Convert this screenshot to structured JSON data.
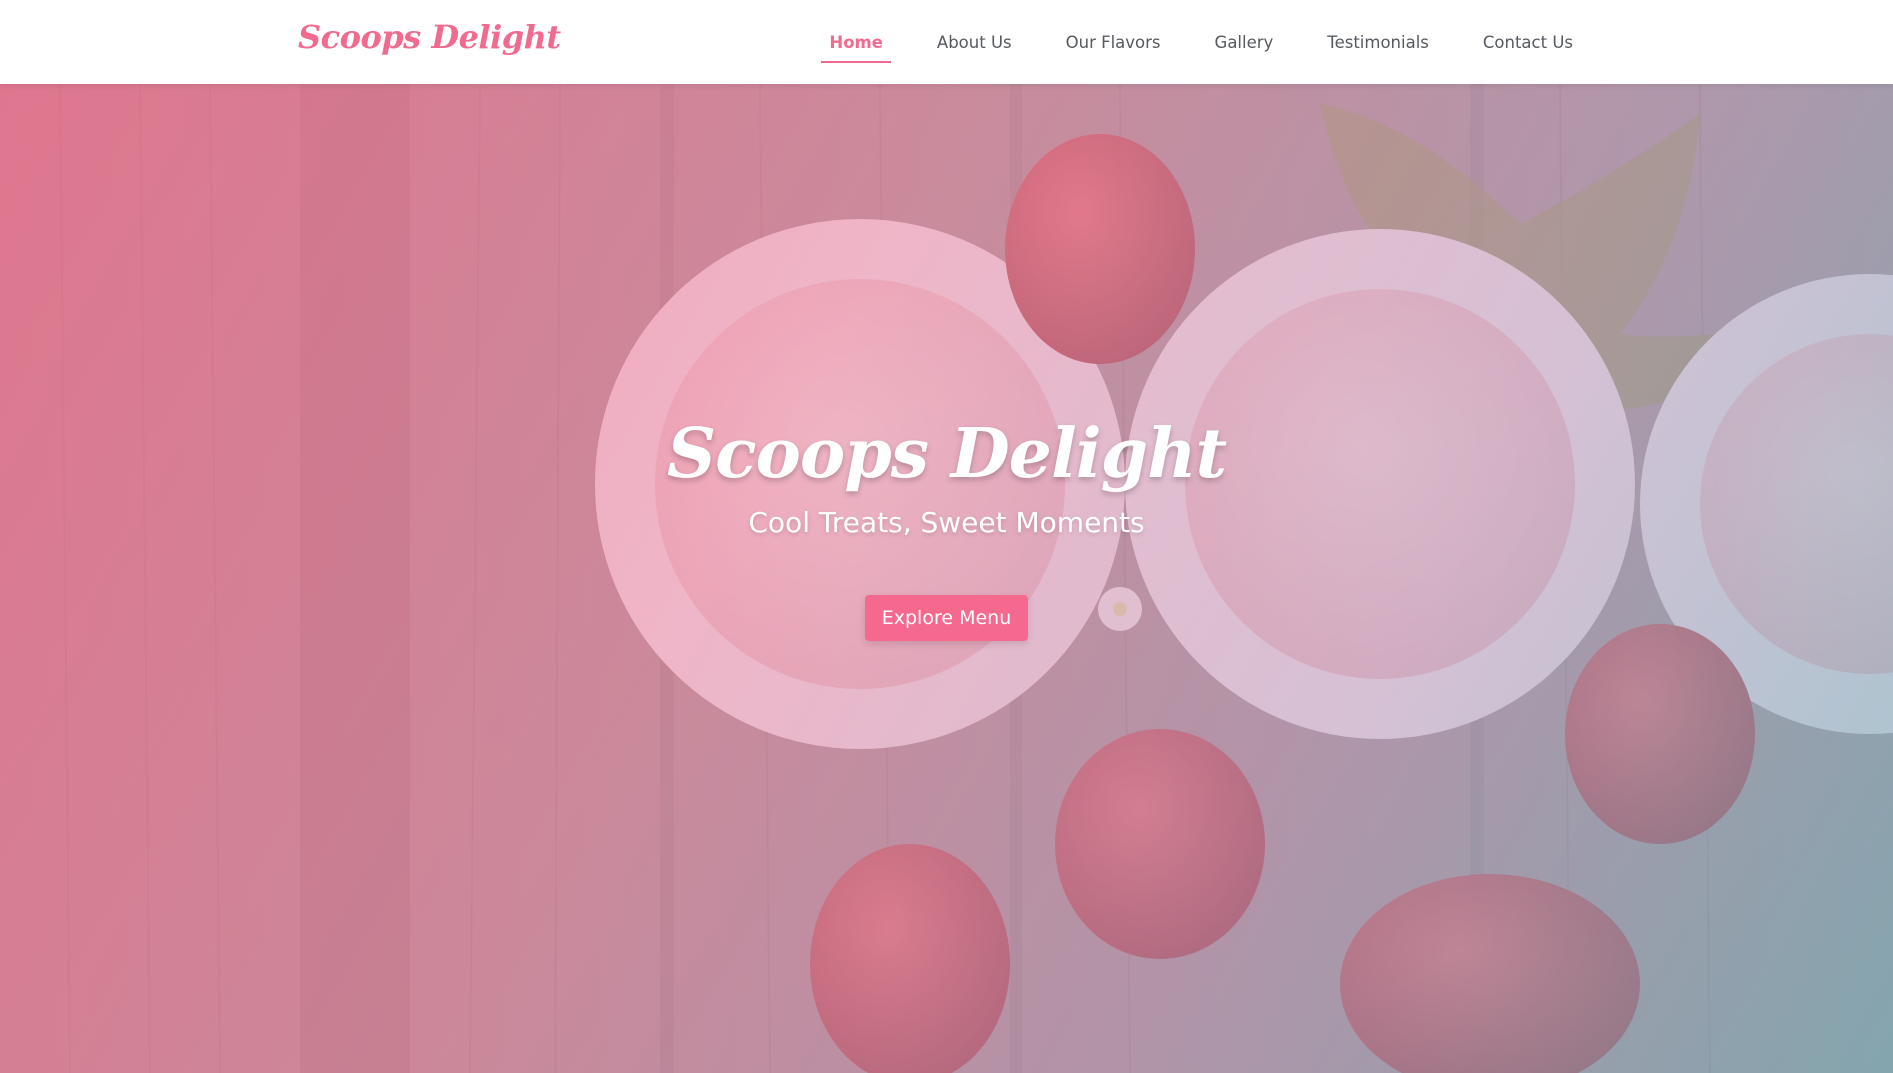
{
  "header": {
    "brand": "Scoops Delight",
    "nav": [
      {
        "label": "Home",
        "active": true
      },
      {
        "label": "About Us",
        "active": false
      },
      {
        "label": "Our Flavors",
        "active": false
      },
      {
        "label": "Gallery",
        "active": false
      },
      {
        "label": "Testimonials",
        "active": false
      },
      {
        "label": "Contact Us",
        "active": false
      }
    ]
  },
  "hero": {
    "title": "Scoops Delight",
    "subtitle": "Cool Treats, Sweet Moments",
    "cta_label": "Explore Menu",
    "background_image": "strawberry-ice-cream-bowls-on-wood"
  },
  "colors": {
    "accent": "#f06b8e",
    "button": "#f6698f",
    "nav_text": "#555a60"
  }
}
